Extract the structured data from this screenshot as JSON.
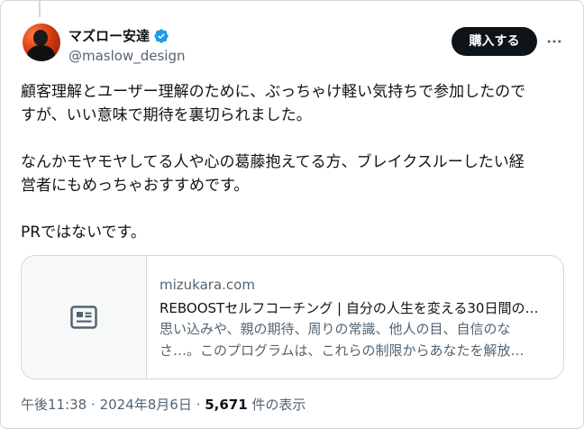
{
  "author": {
    "display_name": "マズロー安達",
    "handle": "@maslow_design",
    "verified": true,
    "verified_color": "#1d9bf0"
  },
  "subscribe_label": "購入する",
  "more_icon": "more-horizontal-icon",
  "tweet": {
    "line1": "顧客理解とユーザー理解のために、ぶっちゃけ軽い気持ちで参加したので",
    "line2": "すが、いい意味で期待を裏切られました。",
    "line3": "なんかモヤモヤしてる人や心の葛藤抱えてる方、ブレイクスルーしたい経",
    "line4": "営者にもめっちゃおすすめです。",
    "line5": "PRではないです。"
  },
  "link_card": {
    "icon": "article-icon",
    "domain": "mizukara.com",
    "title": "REBOOSTセルフコーチング | 自分の人生を変える30日間の…",
    "desc_line1": "思い込みや、親の期待、周りの常識、他人の目、自信のな",
    "desc_line2": "さ…。このプログラムは、これらの制限からあなたを解放…"
  },
  "meta": {
    "time": "午後11:38",
    "separator1": "·",
    "date": "2024年8月6日",
    "separator2": "·",
    "views_count": "5,671",
    "views_label": "件の表示"
  }
}
